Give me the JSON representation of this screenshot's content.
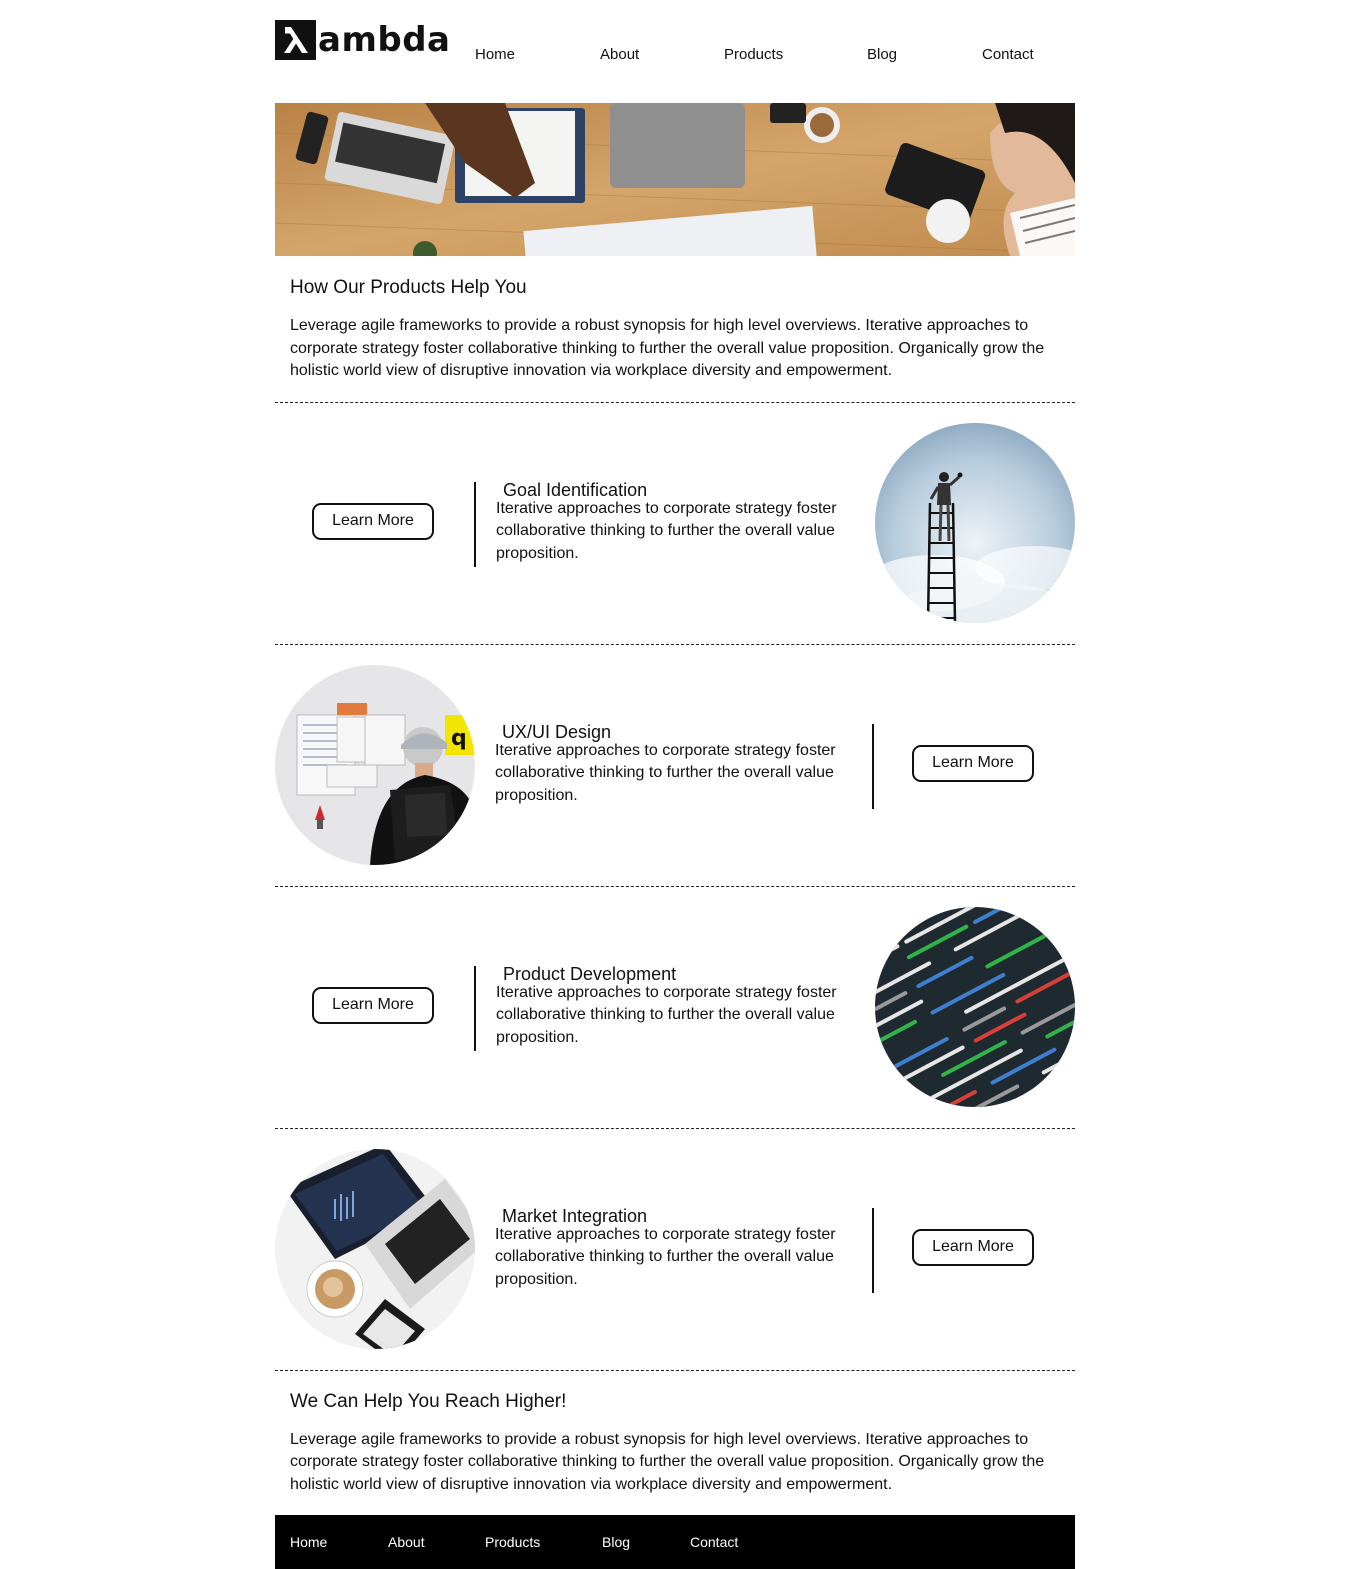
{
  "brand": {
    "logo_symbol": "λ",
    "logo_text": "ambda"
  },
  "nav": [
    {
      "label": "Home"
    },
    {
      "label": "About"
    },
    {
      "label": "Products"
    },
    {
      "label": "Blog"
    },
    {
      "label": "Contact"
    }
  ],
  "intro": {
    "title": "How Our Products Help You",
    "body": "Leverage agile frameworks to provide a robust synopsis for high level overviews. Iterative approaches to corporate strategy foster collaborative thinking to further the overall value proposition. Organically grow the holistic world view of disruptive innovation via workplace diversity and empowerment."
  },
  "features": [
    {
      "title": "Goal Identification",
      "text": "Iterative approaches to corporate strategy foster collaborative thinking to further the overall value proposition.",
      "button": "Learn More",
      "image": "ladder-in-sky"
    },
    {
      "title": "UX/UI Design",
      "text": "Iterative approaches to corporate strategy foster collaborative thinking to further the overall value proposition.",
      "button": "Learn More",
      "image": "man-at-wireframe-wall"
    },
    {
      "title": "Product Development",
      "text": "Iterative approaches to corporate strategy foster collaborative thinking to further the overall value proposition.",
      "button": "Learn More",
      "image": "code-screen"
    },
    {
      "title": "Market Integration",
      "text": "Iterative approaches to corporate strategy foster collaborative thinking to further the overall value proposition.",
      "button": "Learn More",
      "image": "laptop-coffee-phone"
    }
  ],
  "outro": {
    "title": "We Can Help You Reach Higher!",
    "body": "Leverage agile frameworks to provide a robust synopsis for high level overviews. Iterative approaches to corporate strategy foster collaborative thinking to further the overall value proposition. Organically grow the holistic world view of disruptive innovation via workplace diversity and empowerment."
  },
  "footer_nav": [
    {
      "label": "Home"
    },
    {
      "label": "About"
    },
    {
      "label": "Products"
    },
    {
      "label": "Blog"
    },
    {
      "label": "Contact"
    }
  ],
  "colors": {
    "text": "#111111",
    "background": "#ffffff",
    "footer_bg": "#000000",
    "footer_text": "#ffffff"
  }
}
